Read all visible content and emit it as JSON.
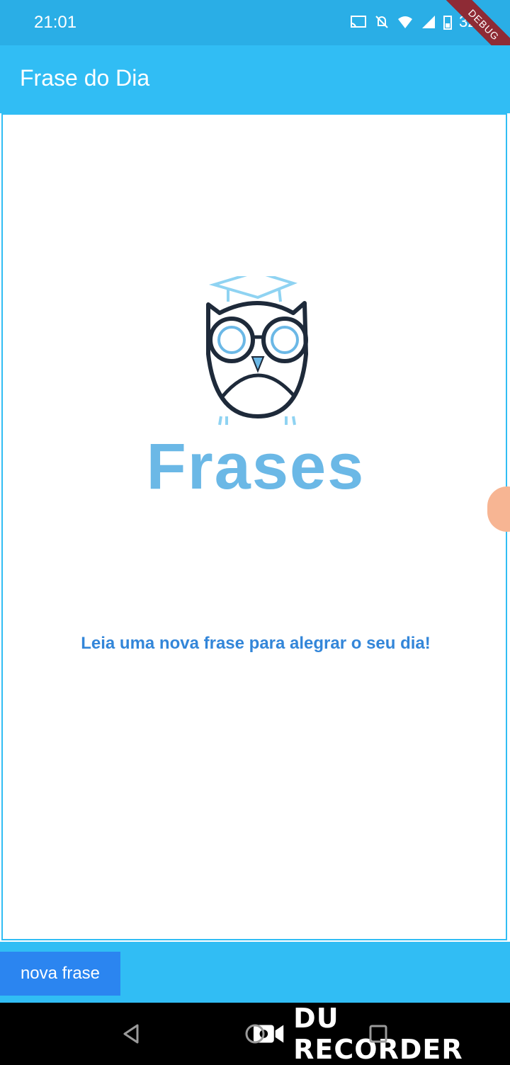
{
  "status_bar": {
    "time": "21:01",
    "battery": "32%",
    "debug_label": "DEBUG"
  },
  "app_bar": {
    "title": "Frase do Dia"
  },
  "main": {
    "logo_text": "Frases",
    "message": "Leia uma nova frase para alegrar o seu dia!"
  },
  "bottom": {
    "button_label": "nova frase"
  },
  "overlay": {
    "watermark": "DU RECORDER"
  },
  "colors": {
    "app_bar": "#31bdf4",
    "status_bar": "#2aaee6",
    "button": "#2b85f0",
    "message_text": "#3386d9",
    "logo_text": "#6bb8e6"
  }
}
